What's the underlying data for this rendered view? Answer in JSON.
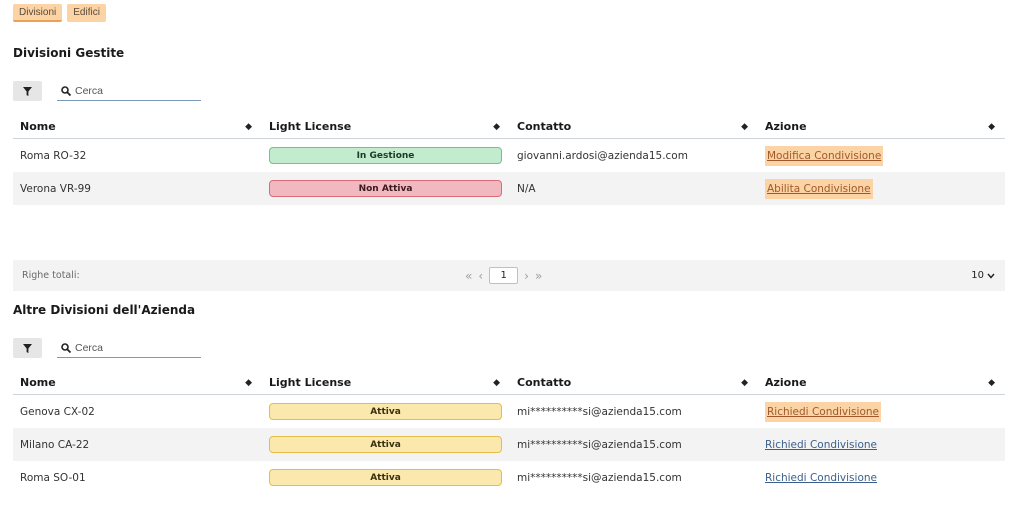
{
  "tabs": [
    {
      "label": "Divisioni"
    },
    {
      "label": "Edifici"
    }
  ],
  "managed": {
    "title": "Divisioni Gestite",
    "search_placeholder": "Cerca",
    "columns": [
      "Nome",
      "Light License",
      "Contatto",
      "Azione"
    ],
    "rows": [
      {
        "name": "Roma RO-32",
        "license": "In Gestione",
        "license_color": "green",
        "contact": "giovanni.ardosi@azienda15.com",
        "action": "Modifica Condivisione"
      },
      {
        "name": "Verona VR-99",
        "license": "Non Attiva",
        "license_color": "red",
        "contact": "N/A",
        "action": "Abilita Condivisione"
      }
    ]
  },
  "pagination": {
    "totals_label": "Righe totali:",
    "first": "«",
    "prev": "‹",
    "current_page": "1",
    "next": "›",
    "last": "»",
    "page_size": "10"
  },
  "other": {
    "title": "Altre Divisioni dell'Azienda",
    "search_placeholder": "Cerca",
    "columns": [
      "Nome",
      "Light License",
      "Contatto",
      "Azione"
    ],
    "rows": [
      {
        "name": "Genova CX-02",
        "license": "Attiva",
        "license_color": "yellow",
        "contact": "mi**********si@azienda15.com",
        "action": "Richiedi Condivisione"
      },
      {
        "name": "Milano CA-22",
        "license": "Attiva",
        "license_color": "yellow",
        "contact": "mi**********si@azienda15.com",
        "action": "Richiedi Condivisione"
      },
      {
        "name": "Roma SO-01",
        "license": "Attiva",
        "license_color": "yellow",
        "contact": "mi**********si@azienda15.com",
        "action": "Richiedi Condivisione"
      }
    ]
  },
  "colors": {
    "highlight": "#fbd3a4",
    "link": "#3c5f8a",
    "green_badge": "#c3ebce",
    "red_badge": "#f2b8c0",
    "yellow_badge": "#fbe8ad"
  },
  "icons": {
    "filter": "funnel-icon",
    "search": "magnifier-icon",
    "sort": "sort-icon",
    "dropdown": "chevron-down-icon"
  }
}
